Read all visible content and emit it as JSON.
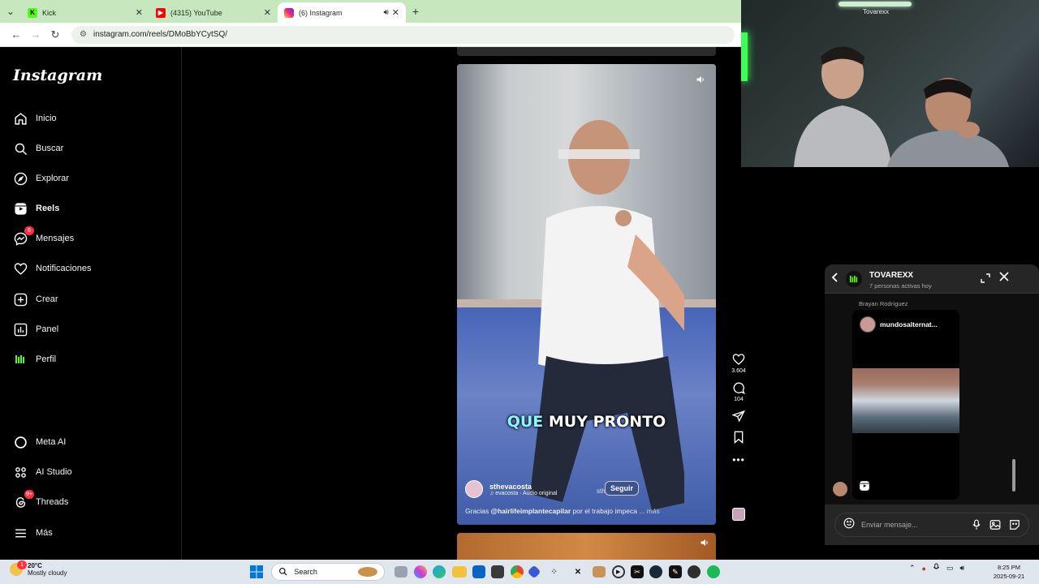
{
  "browser": {
    "tabs": [
      {
        "title": "Kick",
        "active": false,
        "favicon_color": "#53fc18"
      },
      {
        "title": "(4315) YouTube",
        "active": false,
        "favicon_color": "#ff0000"
      },
      {
        "title": "(6) Instagram",
        "active": true,
        "favicon_color": "#e1306c"
      }
    ],
    "url": "instagram.com/reels/DMoBbYCytSQ/"
  },
  "sidebar": {
    "logo": "Instagram",
    "items": [
      {
        "label": "Inicio",
        "icon": "home-icon"
      },
      {
        "label": "Buscar",
        "icon": "search-icon"
      },
      {
        "label": "Explorar",
        "icon": "compass-icon"
      },
      {
        "label": "Reels",
        "icon": "reels-icon"
      },
      {
        "label": "Mensajes",
        "icon": "messenger-icon",
        "badge": "6"
      },
      {
        "label": "Notificaciones",
        "icon": "heart-icon"
      },
      {
        "label": "Crear",
        "icon": "plus-square-icon"
      },
      {
        "label": "Panel",
        "icon": "chart-icon"
      },
      {
        "label": "Perfil",
        "icon": "profile-icon"
      }
    ],
    "bottom_items": [
      {
        "label": "Meta AI",
        "icon": "meta-ai-icon"
      },
      {
        "label": "AI Studio",
        "icon": "ai-studio-icon"
      },
      {
        "label": "Threads",
        "icon": "threads-icon",
        "badge": "9+"
      },
      {
        "label": "Más",
        "icon": "menu-icon"
      }
    ]
  },
  "reel": {
    "caption_word1": "QUE",
    "caption_rest": "MUY PRONTO",
    "author": "sthevacosta",
    "audio": "evacosta · Audio original",
    "follow_label": "Seguir",
    "sth": "sth",
    "desc_prefix": "Gracias",
    "desc_mention": "@hairlifeimplantecapilar",
    "desc_rest": " por el trabajo impeca",
    "desc_more": " ... más",
    "likes": "3.604",
    "comments": "104"
  },
  "cam": {
    "brand": "Tovarexx"
  },
  "dm": {
    "name": "TOVAREXX",
    "status": "7 personas activas hoy",
    "sender": "Brayan Rodríguez",
    "card_user": "mundosalternat...",
    "input_placeholder": "Enviar mensaje..."
  },
  "taskbar": {
    "temp": "20°C",
    "condition": "Mostly cloudy",
    "weather_badge": "1",
    "search_label": "Search",
    "time": "8:25 PM",
    "date": "2025-09-21"
  }
}
